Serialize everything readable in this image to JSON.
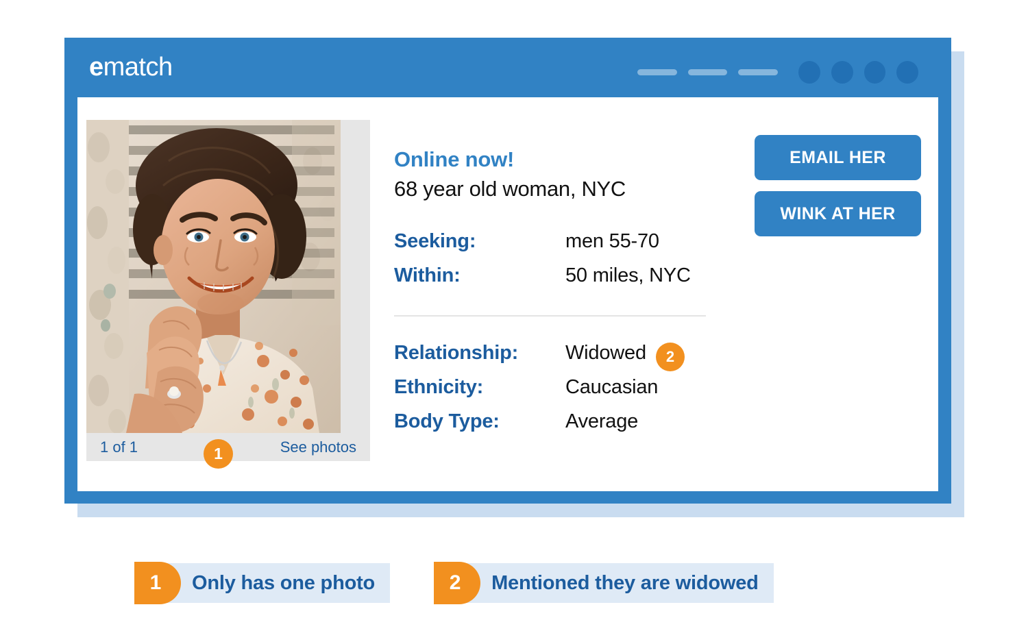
{
  "theme": {
    "blue": "#3182c4",
    "dark_blue": "#1c5c9e",
    "orange": "#f2901f",
    "light_blue_bar": "#dfeaf6",
    "shadow_blue": "#c9dcf0",
    "gray_strip": "#e6e6e6"
  },
  "window": {
    "logo_first": "e",
    "logo_rest": "match",
    "chrome": {
      "dashes": 3,
      "dots": 4
    }
  },
  "photo": {
    "counter": "1 of 1",
    "see_photos": "See photos",
    "badge": "1",
    "alt": "Smiling older woman with dark curly hair wearing a floral blouse, hands clasped near her face, leaning against a weathered wall"
  },
  "profile": {
    "status": "Online now!",
    "subtitle": "68 year old woman, NYC",
    "primary_fields": [
      {
        "label": "Seeking:",
        "value": "men 55-70"
      },
      {
        "label": "Within:",
        "value": "50 miles, NYC"
      }
    ],
    "secondary_fields": [
      {
        "label": "Relationship:",
        "value": "Widowed",
        "badge": "2"
      },
      {
        "label": "Ethnicity:",
        "value": "Caucasian"
      },
      {
        "label": "Body Type:",
        "value": "Average"
      }
    ]
  },
  "actions": {
    "email": "EMAIL HER",
    "wink": "WINK AT HER"
  },
  "callouts": [
    {
      "number": "1",
      "text": "Only has one photo"
    },
    {
      "number": "2",
      "text": "Mentioned they are widowed"
    }
  ]
}
